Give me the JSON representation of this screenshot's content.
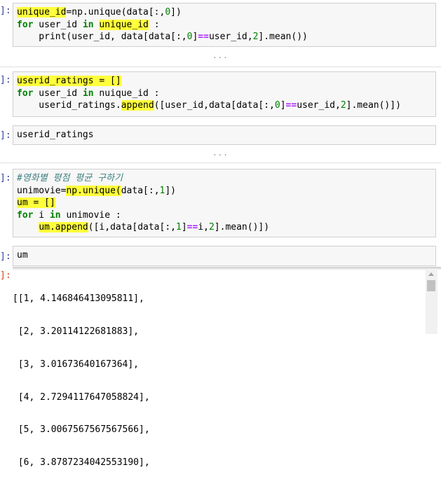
{
  "cells": [
    {
      "prompt": "]:",
      "lines": [
        [
          {
            "t": "unique_id",
            "c": "hl"
          },
          {
            "t": "=np.unique(data[:,"
          },
          {
            "t": "0",
            "c": "num"
          },
          {
            "t": "])"
          }
        ],
        [
          {
            "t": "for",
            "c": "kw"
          },
          {
            "t": " user_id "
          },
          {
            "t": "in",
            "c": "kw"
          },
          {
            "t": " "
          },
          {
            "t": "unique_id",
            "c": "hl"
          },
          {
            "t": " :"
          }
        ],
        [
          {
            "t": "    print(user_id, data[data[:,"
          },
          {
            "t": "0",
            "c": "num"
          },
          {
            "t": "]"
          },
          {
            "t": "==",
            "c": "op"
          },
          {
            "t": "user_id,"
          },
          {
            "t": "2",
            "c": "num"
          },
          {
            "t": "].mean())"
          }
        ]
      ]
    },
    {
      "prompt": "]:",
      "lines": [
        [
          {
            "t": "userid_ratings = []",
            "c": "hl"
          }
        ],
        [
          {
            "t": "for",
            "c": "kw"
          },
          {
            "t": " user_id "
          },
          {
            "t": "in",
            "c": "kw"
          },
          {
            "t": " nuique_id :"
          }
        ],
        [
          {
            "t": "    userid_ratings."
          },
          {
            "t": "append",
            "c": "hl"
          },
          {
            "t": "([user_id,data[data[:,"
          },
          {
            "t": "0",
            "c": "num"
          },
          {
            "t": "]"
          },
          {
            "t": "==",
            "c": "op"
          },
          {
            "t": "user_id,"
          },
          {
            "t": "2",
            "c": "num"
          },
          {
            "t": "].mean()])"
          }
        ]
      ]
    },
    {
      "prompt": "]:",
      "lines": [
        [
          {
            "t": "userid_ratings"
          }
        ]
      ]
    },
    {
      "prompt": "]:",
      "lines": [
        [
          {
            "t": "#영화별 평점 평균 구하기",
            "c": "cm"
          }
        ],
        [
          {
            "t": "unimovie="
          },
          {
            "t": "np.unique(",
            "c": "hl"
          },
          {
            "t": "data[:,"
          },
          {
            "t": "1",
            "c": "num"
          },
          {
            "t": "])"
          }
        ],
        [
          {
            "t": "um = []",
            "c": "hl"
          }
        ],
        [
          {
            "t": "for",
            "c": "kw"
          },
          {
            "t": " i "
          },
          {
            "t": "in",
            "c": "kw"
          },
          {
            "t": " unimovie :"
          }
        ],
        [
          {
            "t": "    "
          },
          {
            "t": "um.append",
            "c": "hl"
          },
          {
            "t": "([i,data[data[:,"
          },
          {
            "t": "1",
            "c": "num"
          },
          {
            "t": "]"
          },
          {
            "t": "==",
            "c": "op"
          },
          {
            "t": "i,"
          },
          {
            "t": "2",
            "c": "num"
          },
          {
            "t": "].mean()])"
          }
        ]
      ]
    },
    {
      "prompt": "]:",
      "lines": [
        [
          {
            "t": "um"
          }
        ]
      ]
    }
  ],
  "ellipsis": "...",
  "output": {
    "prompt": "]:",
    "lines": [
      "[[1, 4.146846413095811],",
      " [2, 3.20114122681883],",
      " [3, 3.01673640167364],",
      " [4, 2.7294117647058824],",
      " [5, 3.0067567567567566],",
      " [6, 3.8787234042553190],"
    ]
  }
}
